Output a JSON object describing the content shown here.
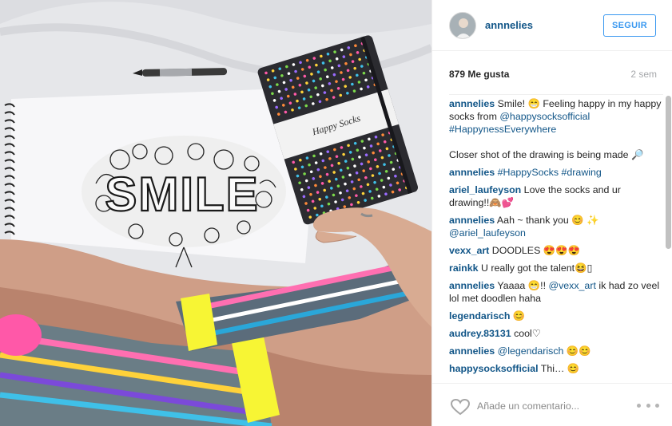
{
  "post": {
    "photo_text": {
      "notebook_brand": "Happy Socks",
      "drawing_word": "SMILE"
    }
  },
  "header": {
    "username": "annnelies",
    "follow_label": "SEGUIR"
  },
  "stats": {
    "likes": "879 Me gusta",
    "time_ago": "2 sem"
  },
  "comments": [
    {
      "user": "annnelies",
      "parts": [
        {
          "t": " Smile! 😁 Feeling happy in my happy socks from "
        },
        {
          "t": "@happysocksofficial",
          "link": true
        },
        {
          "t": " "
        },
        {
          "t": "#HappynessEverywhere",
          "link": true
        },
        {
          "t": "Closer shot of the drawing is being made 🔎",
          "para": true
        }
      ]
    },
    {
      "user": "annnelies",
      "parts": [
        {
          "t": " "
        },
        {
          "t": "#HappySocks",
          "link": true
        },
        {
          "t": " "
        },
        {
          "t": "#drawing",
          "link": true
        }
      ]
    },
    {
      "user": "ariel_laufeyson",
      "parts": [
        {
          "t": " Love the socks and ur drawing!!🙈💕"
        }
      ]
    },
    {
      "user": "annnelies",
      "parts": [
        {
          "t": " Aah ~ thank you 😊 ✨ "
        },
        {
          "t": "@ariel_laufeyson",
          "link": true
        }
      ]
    },
    {
      "user": "vexx_art",
      "parts": [
        {
          "t": " DOODLES 😍😍😍"
        }
      ]
    },
    {
      "user": "rainkk",
      "parts": [
        {
          "t": " U really got the talent😆▯"
        }
      ]
    },
    {
      "user": "annnelies",
      "parts": [
        {
          "t": " Yaaaa 😁!! "
        },
        {
          "t": "@vexx_art",
          "link": true
        },
        {
          "t": " ik had zo veel lol met doodlen haha"
        }
      ]
    },
    {
      "user": "legendarisch",
      "parts": [
        {
          "t": " 😊"
        }
      ]
    },
    {
      "user": "audrey.83131",
      "parts": [
        {
          "t": " cool♡"
        }
      ]
    },
    {
      "user": "annnelies",
      "parts": [
        {
          "t": " "
        },
        {
          "t": "@legendarisch",
          "link": true
        },
        {
          "t": " 😊😊"
        }
      ]
    },
    {
      "user": "happysocksofficial",
      "parts": [
        {
          "t": " Thi… 😊"
        }
      ]
    }
  ],
  "footer": {
    "comment_placeholder": "Añade un comentario...",
    "like_icon": "heart-outline-icon",
    "more_icon": "more-options-icon"
  },
  "colors": {
    "username_blue": "#125688",
    "follow_blue": "#3897f0",
    "muted": "#a5a7aa"
  }
}
